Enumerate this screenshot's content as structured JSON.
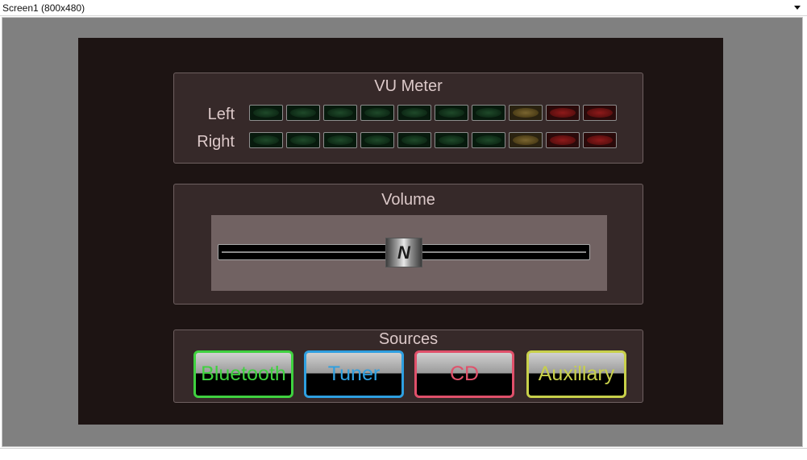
{
  "window": {
    "title": "Screen1 (800x480)"
  },
  "vu_meter": {
    "title": "VU Meter",
    "channels": [
      {
        "label": "Left",
        "segments": [
          "green",
          "green",
          "green",
          "green",
          "green",
          "green",
          "green",
          "yellow",
          "red",
          "red"
        ]
      },
      {
        "label": "Right",
        "segments": [
          "green",
          "green",
          "green",
          "green",
          "green",
          "green",
          "green",
          "yellow",
          "red",
          "red"
        ]
      }
    ]
  },
  "volume": {
    "title": "Volume",
    "value": 0.5
  },
  "sources": {
    "title": "Sources",
    "buttons": [
      {
        "label": "Bluetooth",
        "color": "#3fd13f"
      },
      {
        "label": "Tuner",
        "color": "#2e9fe0"
      },
      {
        "label": "CD",
        "color": "#e0506a"
      },
      {
        "label": "Auxillary",
        "color": "#c8d04a"
      }
    ]
  }
}
